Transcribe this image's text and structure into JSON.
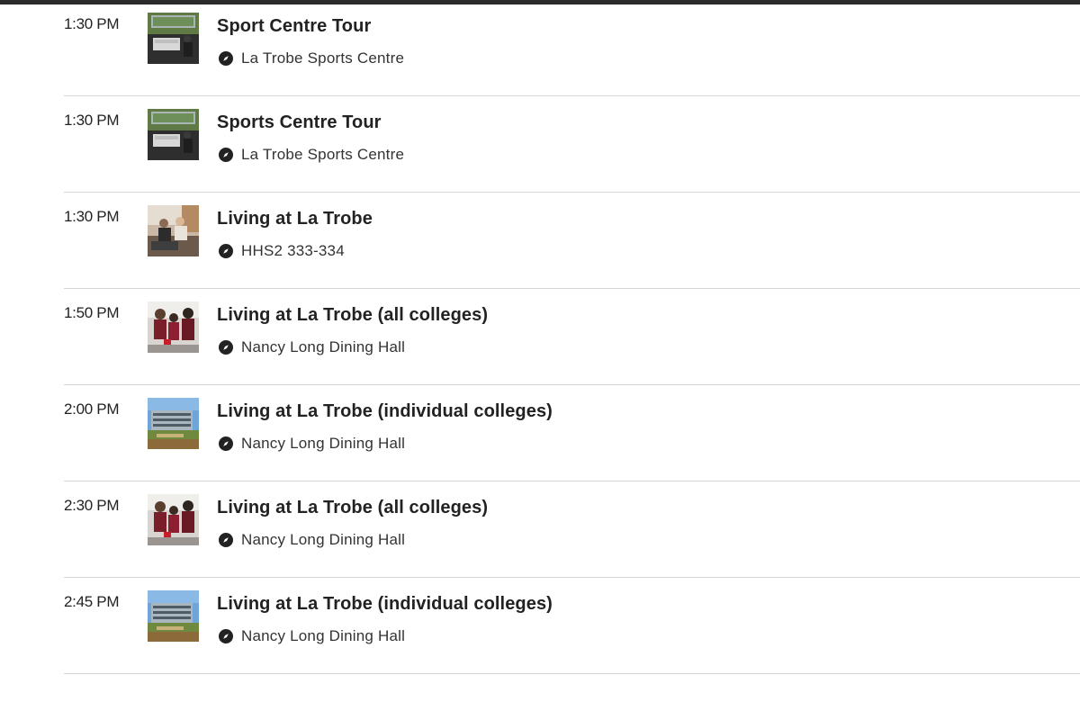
{
  "events": [
    {
      "time": "1:30 PM",
      "title": "Sport Centre Tour",
      "location": "La Trobe Sports Centre",
      "thumbnail": "sports-centre-photo"
    },
    {
      "time": "1:30 PM",
      "title": "Sports Centre Tour",
      "location": "La Trobe Sports Centre",
      "thumbnail": "sports-centre-photo"
    },
    {
      "time": "1:30 PM",
      "title": "Living at La Trobe",
      "location": "HHS2 333-334",
      "thumbnail": "students-lounge-photo"
    },
    {
      "time": "1:50 PM",
      "title": "Living at La Trobe (all colleges)",
      "location": "Nancy Long Dining Hall",
      "thumbnail": "students-group-photo"
    },
    {
      "time": "2:00 PM",
      "title": "Living at La Trobe (individual colleges)",
      "location": "Nancy Long Dining Hall",
      "thumbnail": "college-building-photo"
    },
    {
      "time": "2:30 PM",
      "title": "Living at La Trobe (all colleges)",
      "location": "Nancy Long Dining Hall",
      "thumbnail": "students-group-photo"
    },
    {
      "time": "2:45 PM",
      "title": "Living at La Trobe (individual colleges)",
      "location": "Nancy Long Dining Hall",
      "thumbnail": "college-building-photo"
    }
  ],
  "icons": {
    "location": "compass-icon"
  },
  "colors": {
    "text": "#222222",
    "divider": "#d6d6d6",
    "top_bar": "#2b2b2b"
  }
}
